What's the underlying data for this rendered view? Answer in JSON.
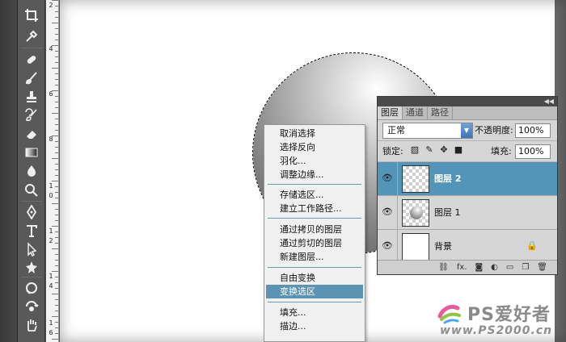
{
  "ruler": {
    "labels": [
      "2",
      "4",
      "6",
      "8",
      "1",
      "0",
      "1",
      "2",
      "1",
      "4",
      "1",
      "6"
    ]
  },
  "layers_panel": {
    "tabs": [
      "图层",
      "通道",
      "路径"
    ],
    "blend_mode": "正常",
    "opacity_label": "不透明度:",
    "opacity_value": "100%",
    "lock_label": "锁定:",
    "fill_label": "填充:",
    "fill_value": "100%",
    "layers": [
      {
        "name": "图层 2",
        "selected": true
      },
      {
        "name": "图层 1",
        "selected": false
      },
      {
        "name": "背景",
        "selected": false
      }
    ],
    "bottom_icons": [
      "link-icon",
      "fx-icon",
      "mask-icon",
      "adjustment-icon",
      "folder-icon",
      "new-layer-icon",
      "trash-icon"
    ],
    "fx_label": "fx."
  },
  "context_menu": {
    "items": [
      "取消选择",
      "选择反向",
      "羽化...",
      "调整边缘...",
      "存储选区...",
      "建立工作路径...",
      "通过拷贝的图层",
      "通过剪切的图层",
      "新建图层...",
      "自由变换",
      "变换选区",
      "填充...",
      "描边..."
    ],
    "highlighted": "变换选区"
  },
  "watermark": {
    "brand": "PS爱好者",
    "url": "www.PS2000.cn"
  },
  "colors": {
    "selection": "#5395b8",
    "menu_highlight": "#5b94b2"
  }
}
